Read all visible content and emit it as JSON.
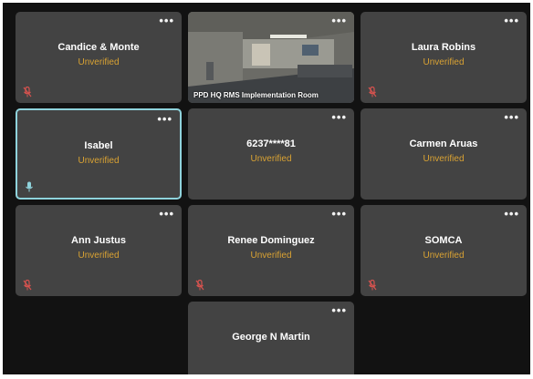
{
  "more_label": "•••",
  "colors": {
    "tile_bg": "#434343",
    "status": "#d9a233",
    "active_border": "#8fd3dc",
    "mic_muted": "#d9534f"
  },
  "tiles": [
    {
      "name": "Candice & Monte",
      "status": "Unverified",
      "mic": "muted-mic-icon"
    },
    {
      "video_caption": "PPD HQ RMS Implementation Room"
    },
    {
      "name": "Laura Robins",
      "status": "Unverified",
      "mic": "muted-mic-icon"
    },
    {
      "name": "Isabel",
      "status": "Unverified",
      "mic": "mic-icon"
    },
    {
      "name": "6237****81",
      "status": "Unverified"
    },
    {
      "name": "Carmen Aruas",
      "status": "Unverified"
    },
    {
      "name": "Ann Justus",
      "status": "Unverified",
      "mic": "muted-mic-icon"
    },
    {
      "name": "Renee Dominguez",
      "status": "Unverified",
      "mic": "muted-mic-icon"
    },
    {
      "name": "SOMCA",
      "status": "Unverified",
      "mic": "muted-mic-icon"
    },
    {
      "name": "George N Martin"
    }
  ]
}
